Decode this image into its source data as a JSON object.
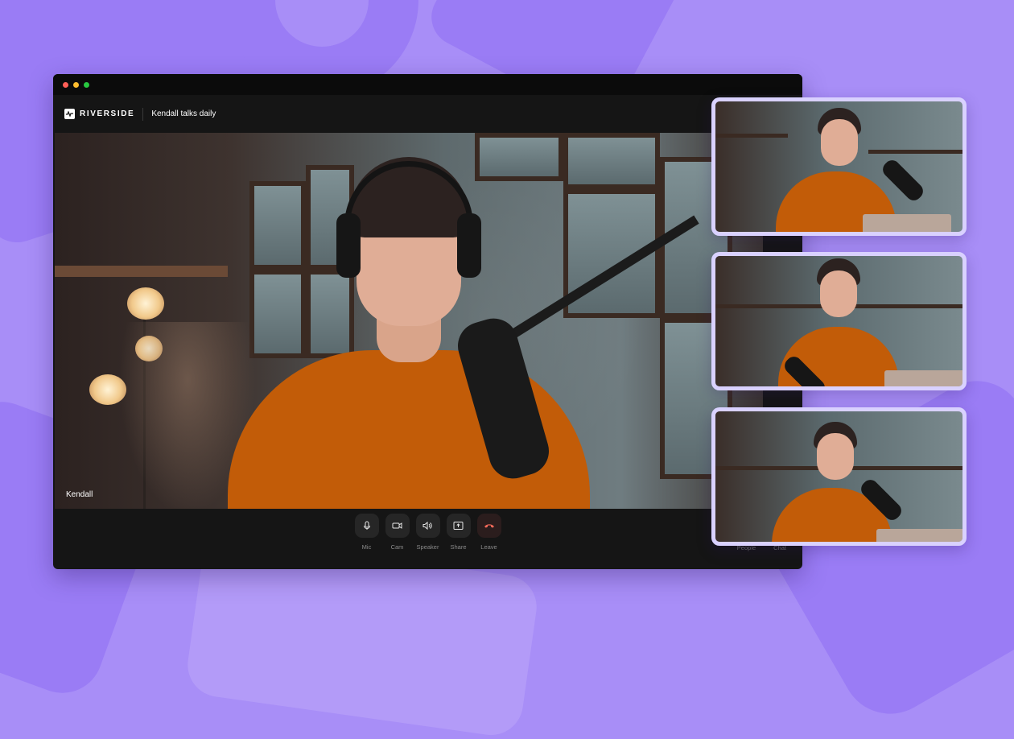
{
  "app": {
    "brand": "RIVERSIDE",
    "session_title": "Kendall talks daily"
  },
  "stage": {
    "speaker_name": "Kendall"
  },
  "controls": [
    {
      "id": "mic",
      "label": "Mic",
      "icon": "microphone-icon"
    },
    {
      "id": "cam",
      "label": "Cam",
      "icon": "camera-icon"
    },
    {
      "id": "speaker",
      "label": "Speaker",
      "icon": "speaker-icon"
    },
    {
      "id": "share",
      "label": "Share",
      "icon": "share-screen-icon"
    },
    {
      "id": "leave",
      "label": "Leave",
      "icon": "hang-up-icon"
    }
  ],
  "side_controls": {
    "people": "People",
    "chat": "Chat"
  },
  "colors": {
    "background": "#a88ef7",
    "window": "#151515",
    "shirt": "#c25c08",
    "tile_border": "#d9d1ff",
    "leave_icon": "#ff6b5b"
  }
}
